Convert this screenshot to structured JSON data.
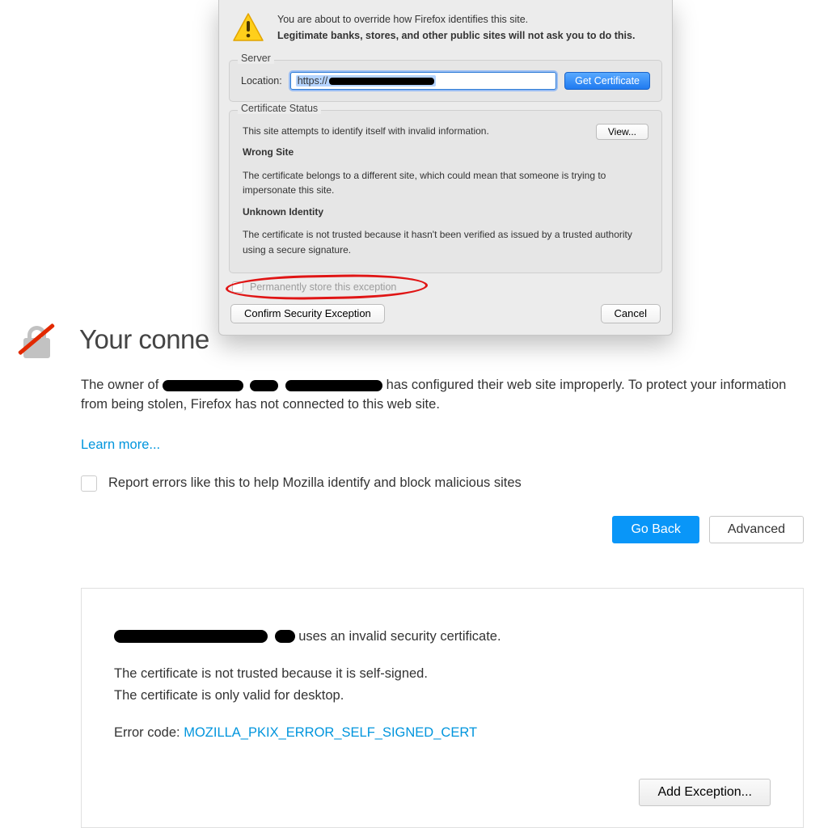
{
  "dialog": {
    "intro_line1": "You are about to override how Firefox identifies this site.",
    "intro_line2": "Legitimate banks, stores, and other public sites will not ask you to do this.",
    "server": {
      "legend": "Server",
      "location_label": "Location:",
      "url_prefix": "https://",
      "get_cert": "Get Certificate"
    },
    "status": {
      "legend": "Certificate Status",
      "intro": "This site attempts to identify itself with invalid information.",
      "view": "View...",
      "wrong_site_h": "Wrong Site",
      "wrong_site_p": "The certificate belongs to a different site, which could mean that someone is trying to impersonate this site.",
      "unknown_h": "Unknown Identity",
      "unknown_p": "The certificate is not trusted because it hasn't been verified as issued by a trusted authority using a secure signature."
    },
    "perm_label": "Permanently store this exception",
    "confirm": "Confirm Security Exception",
    "cancel": "Cancel"
  },
  "page": {
    "title": "Your conne",
    "p1a": "The owner of ",
    "p1b": " has configured their web site improperly. To protect your information from being stolen, Firefox has not connected to this web site.",
    "learn": "Learn more...",
    "report": "Report errors like this to help Mozilla identify and block malicious sites",
    "go_back": "Go Back",
    "advanced": "Advanced",
    "detail": {
      "p1b": " uses an invalid security certificate.",
      "p2": "The certificate is not trusted because it is self-signed.",
      "p3": "The certificate is only valid for desktop.",
      "err_label": "Error code: ",
      "err_code": "MOZILLA_PKIX_ERROR_SELF_SIGNED_CERT",
      "add_exception": "Add Exception..."
    }
  }
}
